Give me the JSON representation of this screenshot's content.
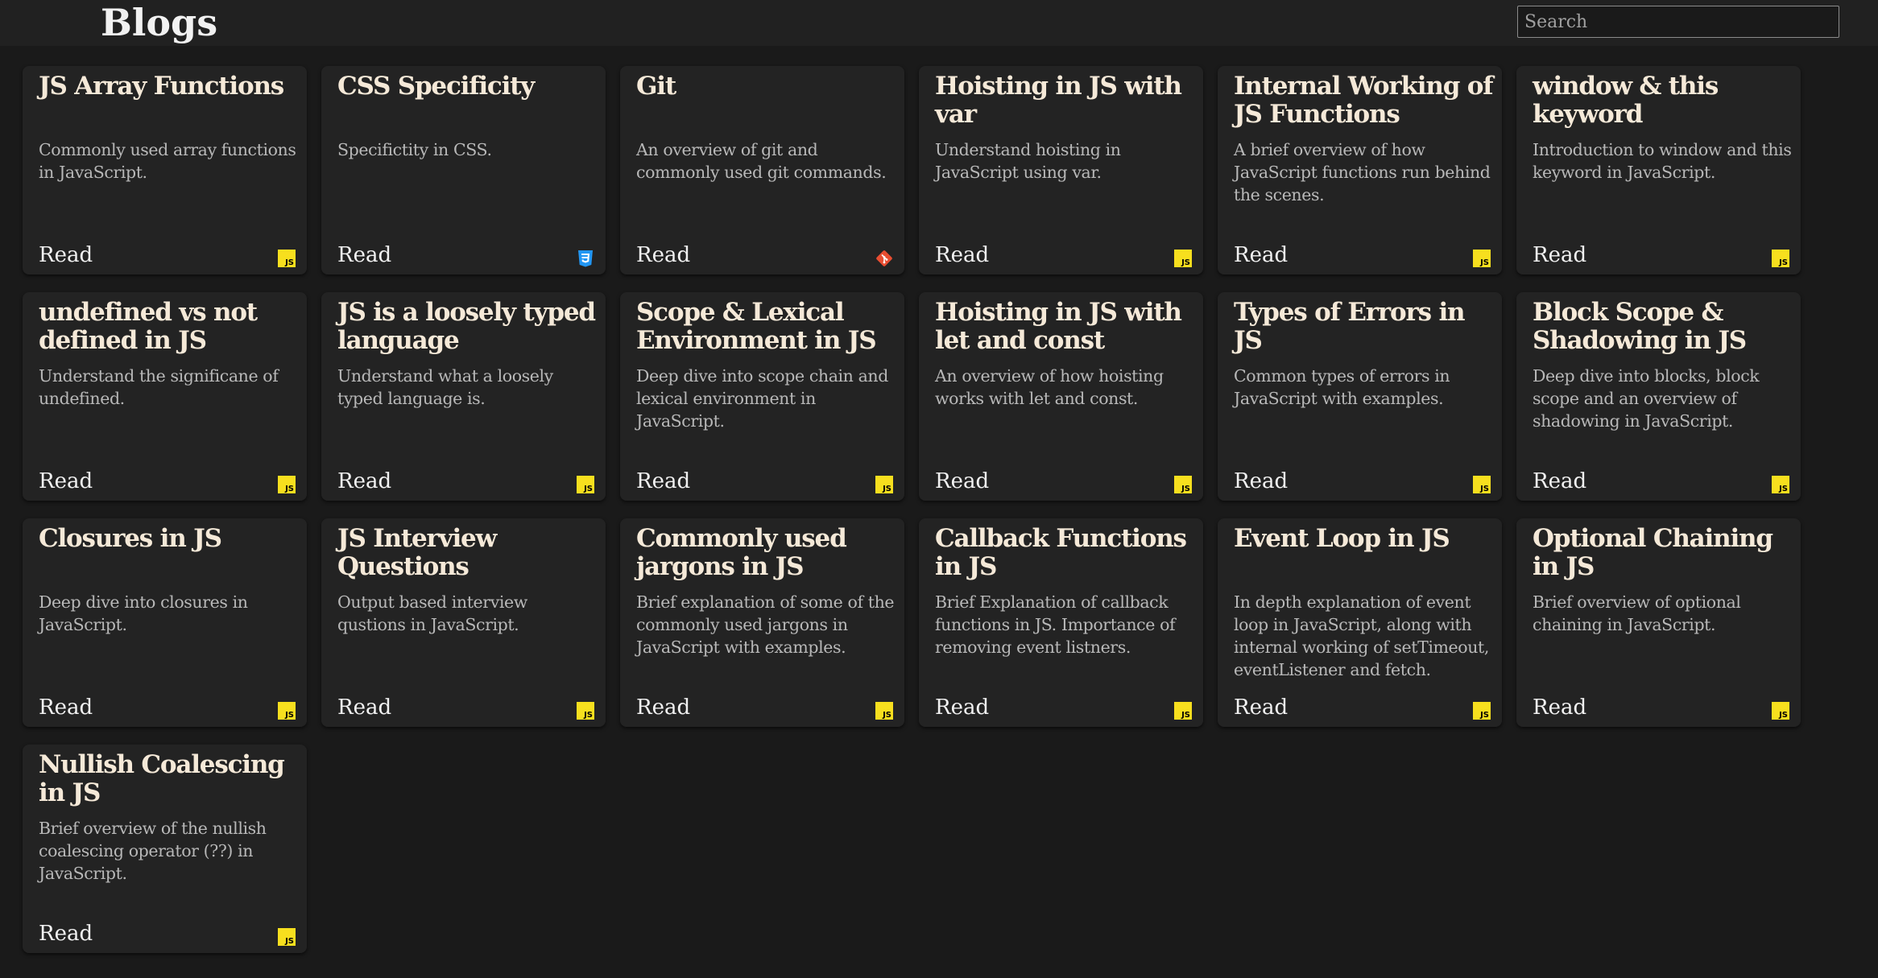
{
  "header": {
    "title": "Blogs",
    "search_placeholder": "Search"
  },
  "posts": [
    {
      "title": "JS Array Functions",
      "description": "Commonly used array functions in JavaScript.",
      "link_label": "Read",
      "icon": "javascript-icon"
    },
    {
      "title": "CSS Specificity",
      "description": "Specifictity in CSS.",
      "link_label": "Read",
      "icon": "css3-icon"
    },
    {
      "title": "Git",
      "description": "An overview of git and commonly used git commands.",
      "link_label": "Read",
      "icon": "git-icon"
    },
    {
      "title": "Hoisting in JS with var",
      "description": "Understand hoisting in JavaScript using var.",
      "link_label": "Read",
      "icon": "javascript-icon"
    },
    {
      "title": "Internal Working of JS Functions",
      "description": "A brief overview of how JavaScript functions run behind the scenes.",
      "link_label": "Read",
      "icon": "javascript-icon"
    },
    {
      "title": "window & this keyword",
      "description": "Introduction to window and this keyword in JavaScript.",
      "link_label": "Read",
      "icon": "javascript-icon"
    },
    {
      "title": "undefined vs not defined in JS",
      "description": "Understand the significane of undefined.",
      "link_label": "Read",
      "icon": "javascript-icon"
    },
    {
      "title": "JS is a loosely typed language",
      "description": "Understand what a loosely typed language is.",
      "link_label": "Read",
      "icon": "javascript-icon"
    },
    {
      "title": "Scope & Lexical Environment in JS",
      "description": "Deep dive into scope chain and lexical environment in JavaScript.",
      "link_label": "Read",
      "icon": "javascript-icon"
    },
    {
      "title": "Hoisting in JS with let and const",
      "description": "An overview of how hoisting works with let and const.",
      "link_label": "Read",
      "icon": "javascript-icon"
    },
    {
      "title": "Types of Errors in JS",
      "description": "Common types of errors in JavaScript with examples.",
      "link_label": "Read",
      "icon": "javascript-icon"
    },
    {
      "title": "Block Scope & Shadowing in JS",
      "description": "Deep dive into blocks, block scope and an overview of shadowing in JavaScript.",
      "link_label": "Read",
      "icon": "javascript-icon"
    },
    {
      "title": "Closures in JS",
      "description": "Deep dive into closures in JavaScript.",
      "link_label": "Read",
      "icon": "javascript-icon"
    },
    {
      "title": "JS Interview Questions",
      "description": "Output based interview qustions in JavaScript.",
      "link_label": "Read",
      "icon": "javascript-icon"
    },
    {
      "title": "Commonly used jargons in JS",
      "description": "Brief explanation of some of the commonly used jargons in JavaScript with examples.",
      "link_label": "Read",
      "icon": "javascript-icon"
    },
    {
      "title": "Callback Functions in JS",
      "description": "Brief Explanation of callback functions in JS. Importance of removing event listners.",
      "link_label": "Read",
      "icon": "javascript-icon"
    },
    {
      "title": "Event Loop in JS",
      "description": "In depth explanation of event loop in JavaScript, along with internal working of setTimeout, eventListener and fetch.",
      "link_label": "Read",
      "icon": "javascript-icon"
    },
    {
      "title": "Optional Chaining in JS",
      "description": "Brief overview of optional chaining in JavaScript.",
      "link_label": "Read",
      "icon": "javascript-icon"
    },
    {
      "title": "Nullish Coalescing in JS",
      "description": "Brief overview of the nullish coalescing operator (??) in JavaScript.",
      "link_label": "Read",
      "icon": "javascript-icon"
    }
  ],
  "colors": {
    "page_background": "#1a1a1a",
    "header_background": "#212121",
    "card_background": "#232323",
    "title_text": "#f5e9d8",
    "description_text": "#b8b8b8",
    "js_icon": "#f7df1e",
    "css_icon": "#2196f3",
    "git_icon": "#e84d31"
  }
}
